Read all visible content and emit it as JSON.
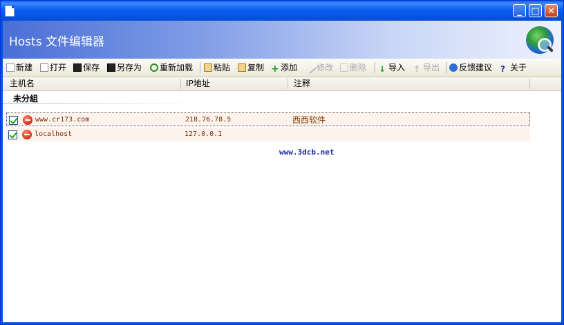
{
  "banner": {
    "title": "Hosts 文件编辑器"
  },
  "toolbar": {
    "new": "新建",
    "open": "打开",
    "save": "保存",
    "save_as": "另存为",
    "reload": "重新加载",
    "paste": "粘贴",
    "copy": "复制",
    "add": "添加",
    "edit": "修改",
    "delete": "删除",
    "import": "导入",
    "export": "导出",
    "feedback": "反馈建议",
    "about": "关于"
  },
  "table": {
    "headers": {
      "host": "主机名",
      "ip": "IP地址",
      "note": "注释"
    },
    "group": "未分組",
    "rows": [
      {
        "host": "www.cr173.com",
        "ip": "218.76.78.5",
        "note": "西西软件",
        "checked": true,
        "selected": true
      },
      {
        "host": "localhost",
        "ip": "127.0.0.1",
        "note": "",
        "checked": true,
        "selected": false
      }
    ]
  },
  "watermark": "www.3dcb.net",
  "colors": {
    "title_bar": "#0054e3",
    "banner_start": "#4a6fd6",
    "row_bg": "#fdf3ec",
    "text_host": "#7a2a00"
  }
}
